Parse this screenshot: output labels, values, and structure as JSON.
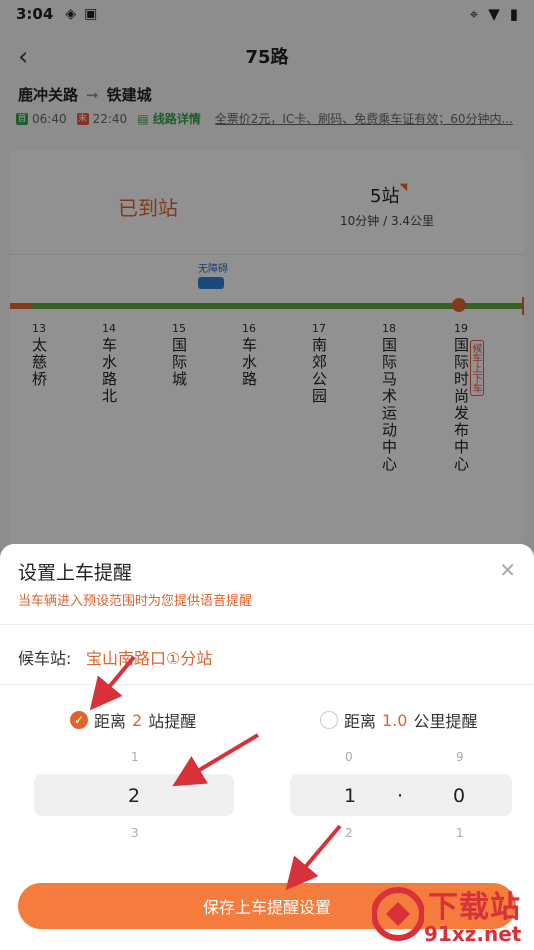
{
  "status": {
    "time": "3:04",
    "icons": [
      "vpn-icon",
      "a-icon",
      "location-icon",
      "wifi-icon",
      "battery-icon"
    ]
  },
  "header": {
    "title": "75路"
  },
  "route": {
    "from": "鹿冲关路",
    "to": "铁建城",
    "start_tag": "首",
    "start_time": "06:40",
    "end_tag": "末",
    "end_time": "22:40",
    "details_link": "线路详情",
    "fare_text": "全票价2元，IC卡、刷码、免费乘车证有效；60分钟内..."
  },
  "arrival": {
    "status": "已到站",
    "stops_count": "5站",
    "distance_text": "10分钟 / 3.4公里"
  },
  "bus_label": "无障碍",
  "stops": [
    {
      "num": "13",
      "name": "太慈桥"
    },
    {
      "num": "14",
      "name": "车水路北"
    },
    {
      "num": "15",
      "name": "国际城"
    },
    {
      "num": "16",
      "name": "车水路"
    },
    {
      "num": "17",
      "name": "南郊公园"
    },
    {
      "num": "18",
      "name": "国际马术运动中心"
    },
    {
      "num": "19",
      "name": "国际时尚发布中心"
    }
  ],
  "stop_badge": "候车上下车",
  "sheet": {
    "title": "设置上车提醒",
    "subtitle": "当车辆进入预设范围时为您提供语音提醒",
    "wait_label": "候车站:",
    "wait_station": "宝山南路口①分站",
    "option1": {
      "prefix": "距离",
      "value": "2",
      "suffix": "站提醒",
      "selected": true
    },
    "option2": {
      "prefix": "距离",
      "value": "1.0",
      "suffix": "公里提醒",
      "selected": false
    },
    "picker_left": {
      "above": "1",
      "current": "2",
      "below": "3"
    },
    "picker_right_int": {
      "above": "0",
      "current": "1",
      "below": "2"
    },
    "picker_right_dot": "·",
    "picker_right_dec": {
      "above": "9",
      "current": "0",
      "below": "1"
    },
    "save_button": "保存上车提醒设置"
  },
  "watermark": {
    "top": "下载站",
    "bottom": "91xz.net"
  },
  "colors": {
    "accent": "#e2622d",
    "green": "#5aaa3d",
    "button": "#f47c3c",
    "arrow": "#d8313a"
  }
}
